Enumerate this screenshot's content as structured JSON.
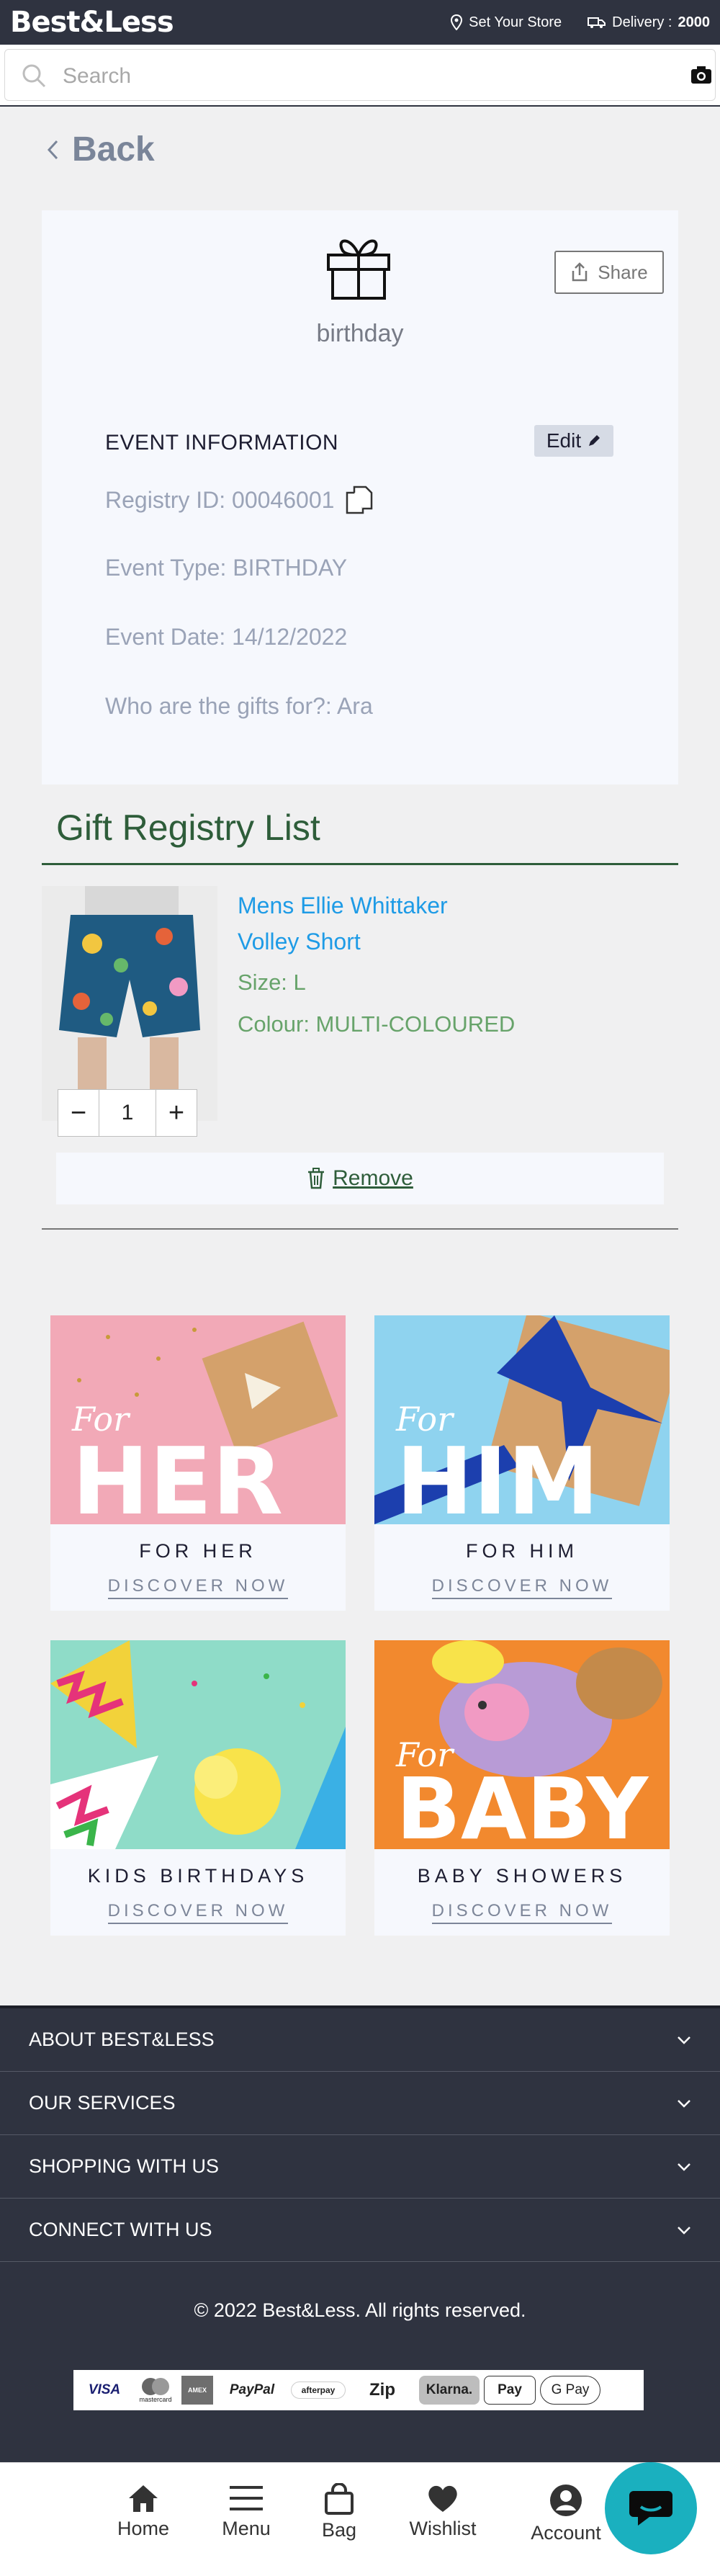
{
  "header": {
    "logo": "Best&Less",
    "store_label": "Set Your Store",
    "delivery_label": "Delivery :",
    "delivery_postcode": "2000"
  },
  "search": {
    "placeholder": "Search"
  },
  "back_label": "Back",
  "event": {
    "name": "birthday",
    "share_label": "Share",
    "section_title": "EVENT INFORMATION",
    "edit_label": "Edit",
    "registry_id": "Registry ID: 00046001",
    "event_type": "Event Type: BIRTHDAY",
    "event_date": "Event Date: 14/12/2022",
    "gifts_for": "Who are the gifts for?: Ara"
  },
  "registry": {
    "title": "Gift Registry List",
    "item": {
      "name_line1": "Mens Ellie Whittaker",
      "name_line2": "Volley Short",
      "size": "Size: L",
      "colour": "Colour: MULTI-COLOURED",
      "quantity": "1",
      "minus": "−",
      "plus": "+"
    },
    "remove_label": "Remove"
  },
  "tiles": [
    {
      "overlay_script": "For",
      "overlay_big": "HER",
      "title": "FOR HER",
      "cta": "DISCOVER NOW"
    },
    {
      "overlay_script": "For",
      "overlay_big": "HIM",
      "title": "FOR HIM",
      "cta": "DISCOVER NOW"
    },
    {
      "overlay_script": "",
      "overlay_big": "",
      "title": "KIDS BIRTHDAYS",
      "cta": "DISCOVER NOW"
    },
    {
      "overlay_script": "For",
      "overlay_big": "BABY",
      "title": "BABY SHOWERS",
      "cta": "DISCOVER NOW"
    }
  ],
  "footer": {
    "sections": [
      "ABOUT BEST&LESS",
      "OUR SERVICES",
      "SHOPPING WITH US",
      "CONNECT WITH US"
    ],
    "copyright": "© 2022 Best&Less. All rights reserved.",
    "payments": [
      "VISA",
      "mastercard",
      "AMEX",
      "PayPal",
      "afterpay",
      "Zip",
      "Klarna.",
      "Pay",
      "G Pay"
    ]
  },
  "nav": {
    "home": "Home",
    "menu": "Menu",
    "bag": "Bag",
    "wishlist": "Wishlist",
    "account": "Account"
  },
  "colors": {
    "header_bg": "#2f3340",
    "accent_green": "#2e5d3a",
    "link_blue": "#1e9be6",
    "chat_teal": "#1ab0bf"
  }
}
